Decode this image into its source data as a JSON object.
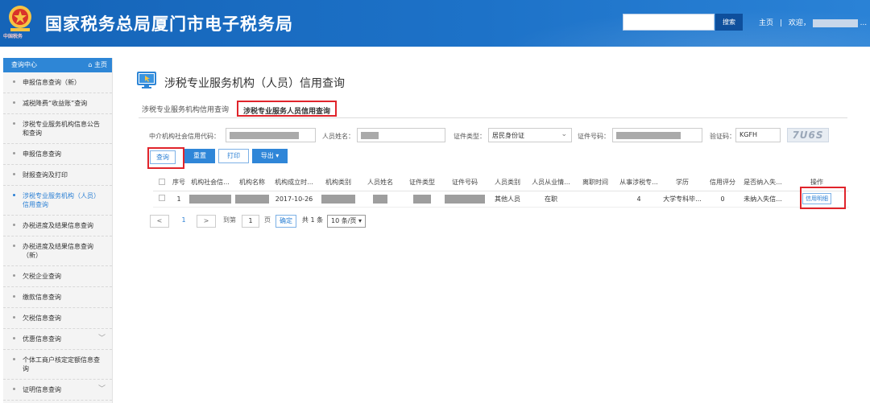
{
  "header": {
    "site_title": "国家税务总局厦门市电子税务局",
    "emblem_text": "中国税务",
    "search_button": "搜索",
    "link_home": "主页",
    "link_welcome": "欢迎，",
    "link_sep": "|",
    "link_trailing": "..."
  },
  "sidebar": {
    "head_label": "查询中心",
    "home_label": "主页",
    "items": [
      {
        "label": "申报信息查询（新）"
      },
      {
        "label": "减税降费“收益账”查询"
      },
      {
        "label": "涉税专业服务机构信息公告和查询"
      },
      {
        "label": "申报信息查询"
      },
      {
        "label": "财报查询及打印"
      },
      {
        "label": "涉税专业服务机构（人员）信用查询"
      },
      {
        "label": "办税进度及结果信息查询"
      },
      {
        "label": "办税进度及结果信息查询（新）"
      },
      {
        "label": "欠税企业查询"
      },
      {
        "label": "缴款信息查询"
      },
      {
        "label": "欠税信息查询"
      },
      {
        "label": "优惠信息查询"
      },
      {
        "label": "个体工商户核定定额信息查询"
      },
      {
        "label": "证明信息查询"
      }
    ]
  },
  "page": {
    "title": "涉税专业服务机构（人员）信用查询",
    "tabs": [
      {
        "label": "涉税专业服务机构信用查询"
      },
      {
        "label": "涉税专业服务人员信用查询"
      }
    ]
  },
  "form": {
    "agency_code_label": "中介机构社会信用代码：",
    "person_name_label": "人员姓名：",
    "id_type_label": "证件类型：",
    "id_type_value": "居民身份证",
    "id_number_label": "证件号码：",
    "captcha_label": "验证码：",
    "captcha_value": "KGFH",
    "captcha_image_text": "7U6S"
  },
  "buttons": {
    "query": "查询",
    "reset": "重置",
    "print": "打印",
    "export": "导出 ▾"
  },
  "table": {
    "headers": [
      "",
      "序号",
      "机构社会信...",
      "机构名称",
      "机构成立时...",
      "机构类别",
      "人员姓名",
      "证件类型",
      "证件号码",
      "人员类别",
      "人员从业情...",
      "离职时间",
      "从事涉税专...",
      "学历",
      "信用评分",
      "是否纳入失...",
      "操作"
    ],
    "rows": [
      {
        "index": "1",
        "founded": "2017-10-26",
        "person_category": "其他人员",
        "employment": "在职",
        "leave_time": "",
        "years": "4",
        "education": "大学专科毕...",
        "score": "0",
        "blacklist": "未纳入失信...",
        "action": "信用明细"
      }
    ]
  },
  "pager": {
    "prev": "<",
    "current_page": "1",
    "next": ">",
    "goto_label": "到第",
    "goto_value": "1",
    "page_unit": "页",
    "confirm": "确定",
    "total": "共 1 条",
    "page_size": "10 条/页"
  }
}
